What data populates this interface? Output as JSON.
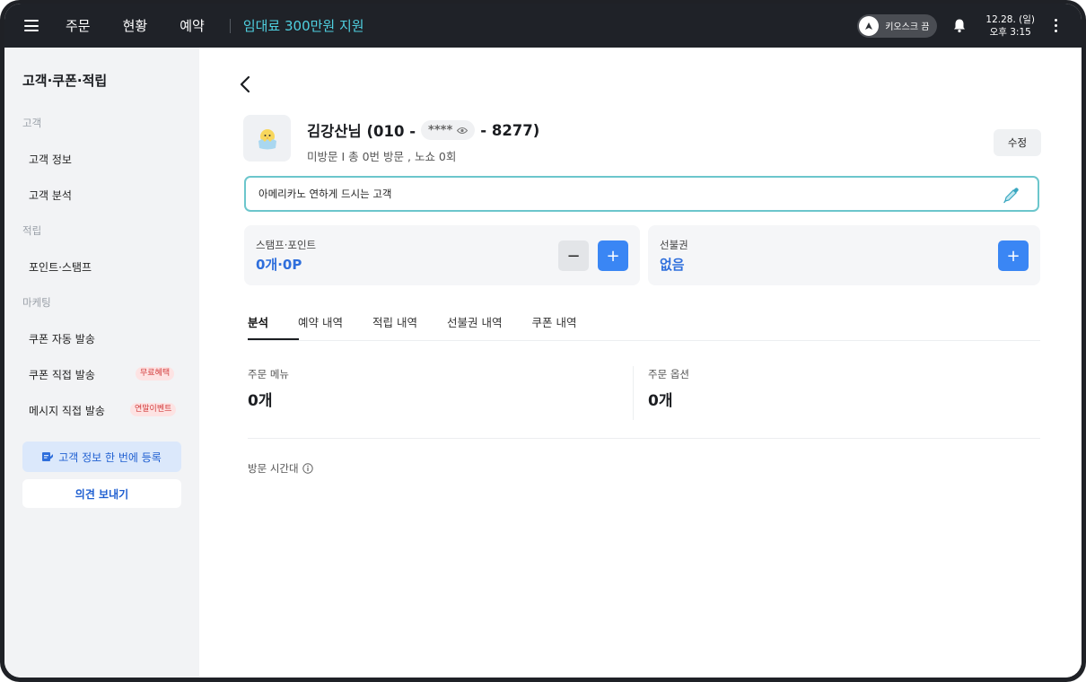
{
  "topbar": {
    "nav": [
      "주문",
      "현황",
      "예약"
    ],
    "promo": "임대료 300만원 지원",
    "kiosk_label": "키오스크 끔",
    "date": "12.28. (일)",
    "time": "오후 3:15"
  },
  "sidebar": {
    "title": "고객·쿠폰·적립",
    "sections": [
      {
        "label": "고객",
        "items": [
          "고객 정보",
          "고객 분석"
        ]
      },
      {
        "label": "적립",
        "items": [
          "포인트·스탬프"
        ]
      },
      {
        "label": "마케팅",
        "items": [
          "쿠폰 자동 발송",
          "쿠폰 직접 발송",
          "메시지 직접 발송"
        ]
      }
    ],
    "badges": {
      "coupon_direct": "무료혜택",
      "message_direct": "연말이벤트"
    },
    "register_button": "고객 정보 한 번에 등록",
    "feedback_button": "의견 보내기"
  },
  "customer": {
    "name_prefix": "김강산님 (010 -",
    "masked": "****",
    "name_suffix": "- 8277)",
    "visit_summary": "미방문 I 총 0번 방문 , 노쇼 0회",
    "edit_button": "수정",
    "memo": "아메리카노 연하게 드시는 고객"
  },
  "cards": {
    "stamp": {
      "label": "스탬프·포인트",
      "value": "0개·0P",
      "minus": "−",
      "plus": "+"
    },
    "prepaid": {
      "label": "선불권",
      "value": "없음",
      "plus": "+"
    }
  },
  "tabs": [
    "분석",
    "예약 내역",
    "적립 내역",
    "선불권 내역",
    "쿠폰 내역"
  ],
  "stats": {
    "order_menu": {
      "label": "주문 메뉴",
      "value": "0개"
    },
    "order_option": {
      "label": "주문 옵션",
      "value": "0개"
    }
  },
  "visit_time_label": "방문 시간대",
  "colors": {
    "accent": "#3a86f4",
    "topbar": "#1f2228",
    "promo": "#4fd0e0",
    "memo_border": "#6cc6cc"
  }
}
